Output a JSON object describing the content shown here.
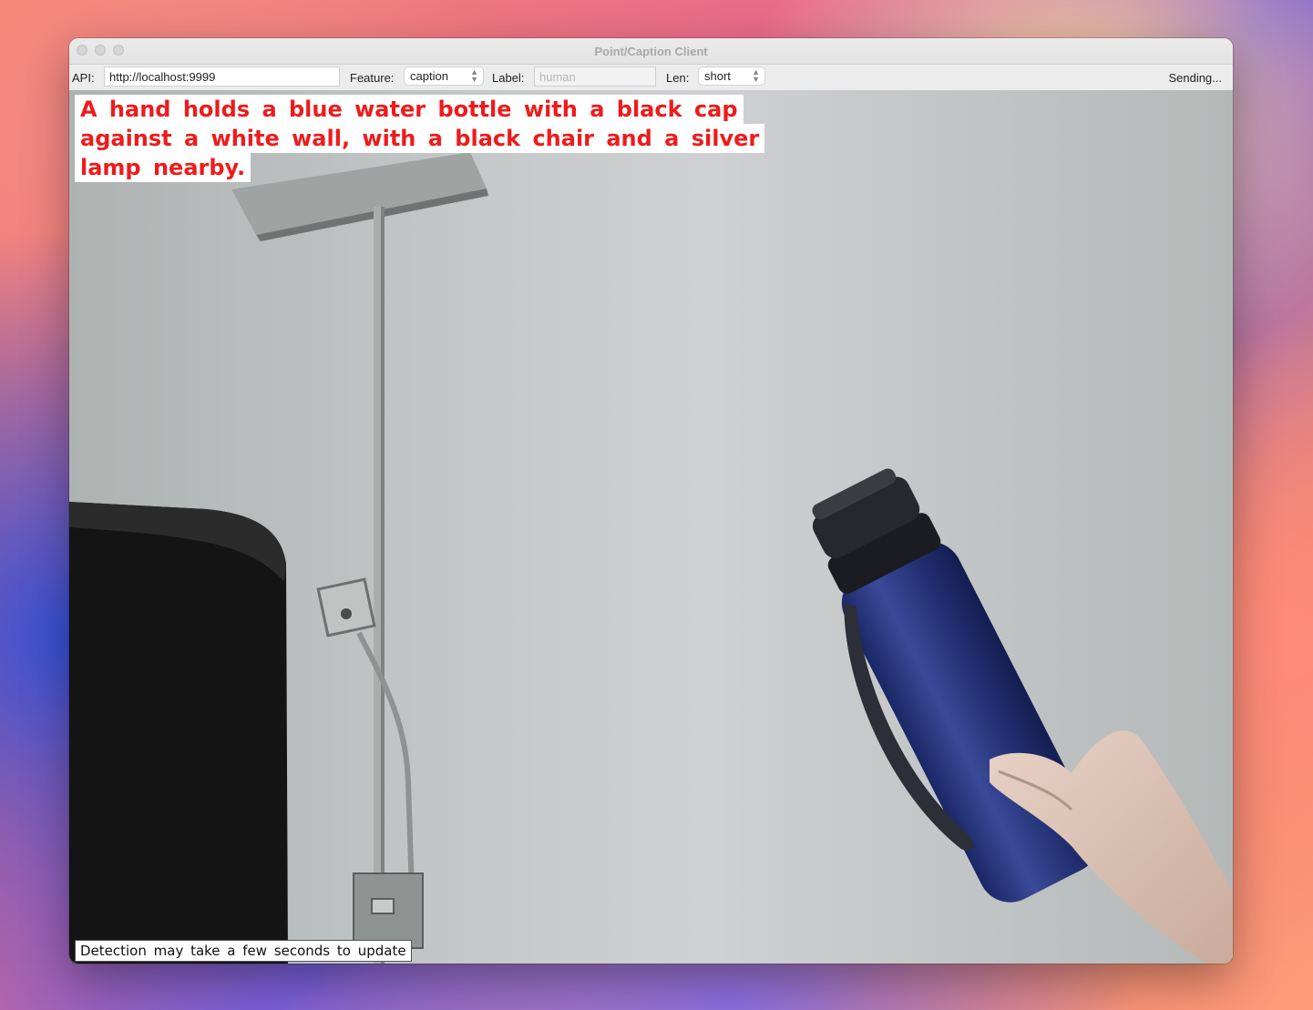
{
  "window": {
    "title": "Point/Caption Client"
  },
  "toolbar": {
    "api_label": "API:",
    "api_value": "http://localhost:9999",
    "feature_label": "Feature:",
    "feature_value": "caption",
    "label_label": "Label:",
    "label_placeholder": "human",
    "len_label": "Len:",
    "len_value": "short",
    "status": "Sending..."
  },
  "overlay": {
    "caption_lines": [
      "A hand holds a blue water bottle with a black cap",
      "against a white wall, with a black chair and a silver",
      "lamp nearby."
    ],
    "note": "Detection may take a few seconds to update"
  },
  "scene_icons": [
    "lamp-icon",
    "chair-icon",
    "water-bottle-icon",
    "hand-icon"
  ]
}
